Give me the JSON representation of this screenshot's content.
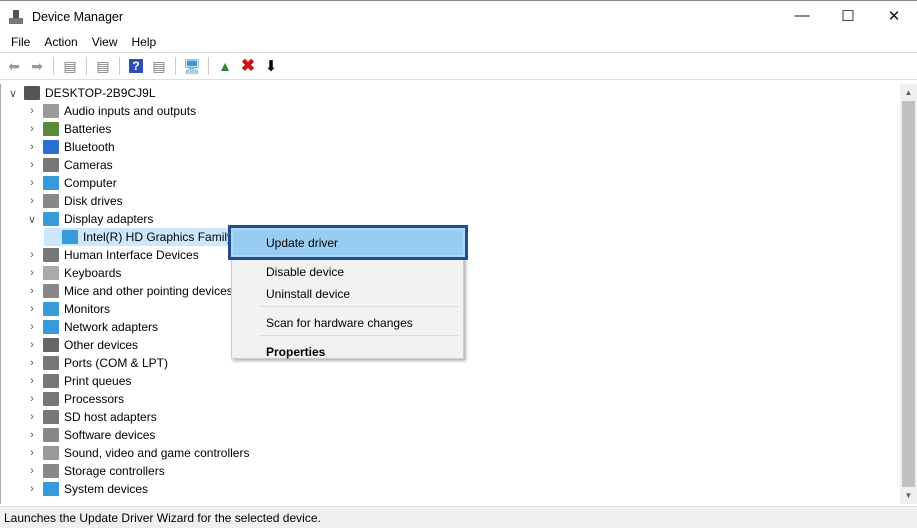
{
  "window": {
    "title": "Device Manager",
    "icon": "device-manager-icon"
  },
  "menu": [
    "File",
    "Action",
    "View",
    "Help"
  ],
  "toolbar": [
    "back-icon",
    "forward-icon",
    "show-hide-console-tree-icon",
    "properties-icon",
    "help-icon",
    "action-pane-icon",
    "scan-hardware-icon",
    "update-driver-icon",
    "uninstall-icon",
    "disable-download-icon"
  ],
  "tree": {
    "root": "DESKTOP-2B9CJ9L",
    "categories": [
      {
        "label": "Audio inputs and outputs",
        "color": "#9a9a9a"
      },
      {
        "label": "Batteries",
        "color": "#5a8a3a"
      },
      {
        "label": "Bluetooth",
        "color": "#2c6fd1"
      },
      {
        "label": "Cameras",
        "color": "#777777"
      },
      {
        "label": "Computer",
        "color": "#3a9ad9"
      },
      {
        "label": "Disk drives",
        "color": "#888888"
      },
      {
        "label": "Display adapters",
        "color": "#3a9ad9",
        "expanded": true,
        "children": [
          "Intel(R) HD Graphics Family"
        ]
      },
      {
        "label": "Human Interface Devices",
        "color": "#777777"
      },
      {
        "label": "Keyboards",
        "color": "#aaaaaa"
      },
      {
        "label": "Mice and other pointing devices",
        "color": "#888888"
      },
      {
        "label": "Monitors",
        "color": "#3a9ad9"
      },
      {
        "label": "Network adapters",
        "color": "#3a9ad9"
      },
      {
        "label": "Other devices",
        "color": "#666666"
      },
      {
        "label": "Ports (COM & LPT)",
        "color": "#777777"
      },
      {
        "label": "Print queues",
        "color": "#777777"
      },
      {
        "label": "Processors",
        "color": "#777777"
      },
      {
        "label": "SD host adapters",
        "color": "#777777"
      },
      {
        "label": "Software devices",
        "color": "#888888"
      },
      {
        "label": "Sound, video and game controllers",
        "color": "#999999"
      },
      {
        "label": "Storage controllers",
        "color": "#888888"
      },
      {
        "label": "System devices",
        "color": "#3a9ad9"
      }
    ]
  },
  "context_menu": {
    "items": [
      "Update driver",
      "Disable device",
      "Uninstall device",
      "Scan for hardware changes",
      "Properties"
    ],
    "highlighted": "Update driver"
  },
  "status": "Launches the Update Driver Wizard for the selected device."
}
